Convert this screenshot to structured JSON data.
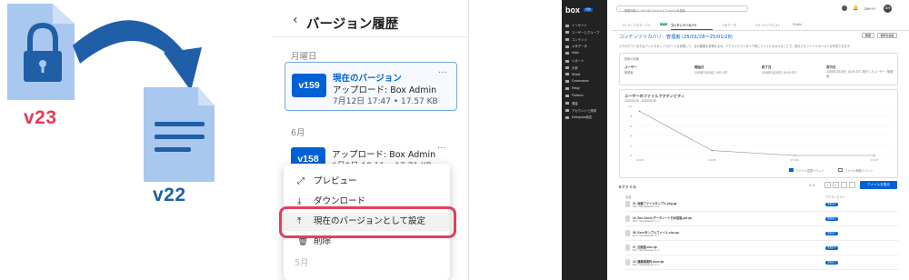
{
  "illustration": {
    "version_a": "v23",
    "version_b": "v22"
  },
  "history_panel": {
    "title": "バージョン履歴",
    "back_icon": "chevron-left-icon",
    "section_1": "月曜日",
    "current": {
      "badge": "v159",
      "status": "現在のバージョン",
      "upload": "アップロード: Box Admin",
      "meta": "7月12日 17:47 • 17.57 KB"
    },
    "section_2": "6月",
    "older": {
      "badge": "v158",
      "upload": "アップロード: Box Admin",
      "meta": "6月9日 18:11 • 17.71 KB"
    },
    "menu": [
      {
        "icon": "preview-icon",
        "label": "プレビュー"
      },
      {
        "icon": "download-icon",
        "label": "ダウンロード"
      },
      {
        "icon": "upload-icon",
        "label": "現在のバージョンとして設定"
      },
      {
        "icon": "trash-icon",
        "label": "削除"
      }
    ],
    "section_3": "5月"
  },
  "admin": {
    "logo": "box",
    "logo_badge": "管理",
    "search_placeholder": "管理対象ユーザーのファイルとファイルを検索",
    "user_initials": "DM",
    "user_label": "DM+Y0",
    "sidebar": [
      "インサイト",
      "ユーザーとグループ",
      "コンテンツ",
      "メタデータ",
      "Hubs",
      "レポート",
      "分析",
      "Shield",
      "Governance",
      "Relay",
      "Platform",
      "課金",
      "アカウントと請求",
      "Enterprise設定"
    ],
    "tabs": [
      "コンテンツマネージャ",
      "コンテンツリカバリ",
      "メタデータ",
      "ファイルリクエスト",
      "Shuttle"
    ],
    "tab_new": "NEW",
    "heading": "コンテンツリカバリ：管理者 (25/01/28〜25/01/28)",
    "desc": "以下のグラフまたはフィルタボックスロールを参照して、目の範囲を参照をまわ。アクティビティタイプ別にファイルをわけることで、復元するファイルのリストを作成できます。",
    "btn_history": "履歴",
    "btn_detail": "検索を編集",
    "summary_title": "検索の対象",
    "summary": {
      "user_label": "ユーザー",
      "user_value": "管理者",
      "start_label": "開始日",
      "start_value": "2025年1月28日, 9:00 JST",
      "end_label": "終了日",
      "end_value": "2025年1月28日, 15:00 JST",
      "exec_label": "実行日",
      "exec_value": "2025年1月28日, 15:55 JST, 実行したユーザー: 管理者"
    },
    "chart_title": "ユーザーのファイルアクティビティ",
    "chart_sub": "2025/01/28 - 2025/01/28",
    "legend_1": "ファイル変更イベント",
    "legend_2": "ファイル削除イベント",
    "files_title": "5ファイル",
    "pager": "1 / 1",
    "btn_restore": "ファイルを復元",
    "col_name": "名前",
    "col_action": "アクティビティ",
    "files": [
      {
        "name": "01_画像ファイルサンプル.png.qa",
        "path": "Box / Sampletest0 / 1.1"
      },
      {
        "name": "04_Box Zones データシート日本語版.pdf.qa",
        "path": "Box / Sampletest0 / 1.1"
      },
      {
        "name": "06_Excelサンプルファイル.xlsx.qa",
        "path": "Box / Sampletest0 / 1.1"
      },
      {
        "name": "07_加速度.xlsx.qa",
        "path": "Box / Sampletest0 / 1.1"
      },
      {
        "name": "10_議事録資料.docx.qa",
        "path": "Box / Sampletest0 / 1.1"
      }
    ],
    "file_status": "変更済み"
  },
  "chart_data": {
    "type": "line",
    "title": "ユーザーのファイルアクティビティ",
    "x": [
      "14:28",
      "14:35",
      "15:00",
      "15:07"
    ],
    "series": [
      {
        "values": [
          0.9,
          0.1,
          0.0,
          0.0
        ]
      }
    ],
    "ylim": [
      0,
      1
    ],
    "yticks": [
      "10",
      "8",
      "6",
      "4",
      "2",
      "0"
    ]
  },
  "colors": {
    "accent": "#0061d5",
    "highlight": "#e0405e",
    "version_text": "#e23b58",
    "arrow": "#1f5fa8",
    "doc": "#a9c8ef"
  }
}
